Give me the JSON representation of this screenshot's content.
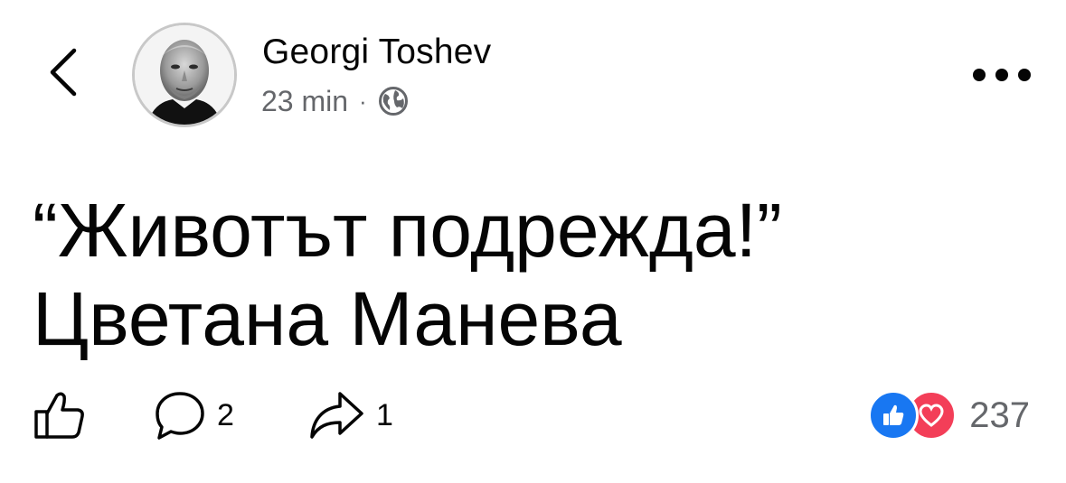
{
  "header": {
    "author": "Georgi Toshev",
    "time": "23 min",
    "separator": "·"
  },
  "post": {
    "line1": "“Животът подрежда!”",
    "line2": "Цветана Манева"
  },
  "actions": {
    "comments_count": "2",
    "shares_count": "1",
    "reactions_total": "237"
  },
  "icons": {
    "back": "chevron-left-icon",
    "privacy": "globe-icon",
    "more": "ellipsis-icon",
    "like": "thumbs-up-icon",
    "comment": "comment-bubble-icon",
    "share": "share-arrow-icon"
  },
  "colors": {
    "like_blue": "#1877f2",
    "love_red": "#f33e58",
    "meta_gray": "#65676b",
    "text": "#050505"
  }
}
